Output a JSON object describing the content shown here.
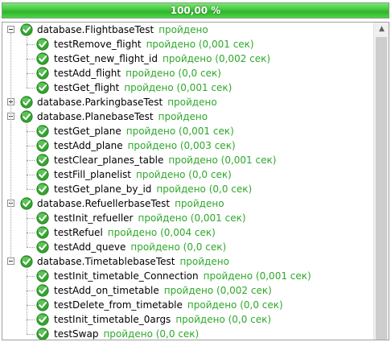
{
  "progress": {
    "label": "100,00 %",
    "fraction": 1.0,
    "color": "#3cc337"
  },
  "status_color": "#2ea82a",
  "icons": {
    "pass": "green-check-icon",
    "expand": "expander-icon",
    "scroll_up": "arrow-up-icon"
  },
  "suites": [
    {
      "name": "database.FlightbaseTest",
      "status": "пройдено",
      "expanded": true,
      "tests": [
        {
          "name": "testRemove_flight",
          "status": "пройдено (0,001 сек)"
        },
        {
          "name": "testGet_new_flight_id",
          "status": "пройдено (0,002 сек)"
        },
        {
          "name": "testAdd_flight",
          "status": "пройдено (0,0 сек)"
        },
        {
          "name": "testGet_flight",
          "status": "пройдено (0,001 сек)"
        }
      ]
    },
    {
      "name": "database.ParkingbaseTest",
      "status": "пройдено",
      "expanded": false,
      "tests": []
    },
    {
      "name": "database.PlanebaseTest",
      "status": "пройдено",
      "expanded": true,
      "tests": [
        {
          "name": "testGet_plane",
          "status": "пройдено (0,001 сек)"
        },
        {
          "name": "testAdd_plane",
          "status": "пройдено (0,003 сек)"
        },
        {
          "name": "testClear_planes_table",
          "status": "пройдено (0,001 сек)"
        },
        {
          "name": "testFill_planelist",
          "status": "пройдено (0,0 сек)"
        },
        {
          "name": "testGet_plane_by_id",
          "status": "пройдено (0,0 сек)"
        }
      ]
    },
    {
      "name": "database.RefuellerbaseTest",
      "status": "пройдено",
      "expanded": true,
      "tests": [
        {
          "name": "testInit_refueller",
          "status": "пройдено (0,001 сек)"
        },
        {
          "name": "testRefuel",
          "status": "пройдено (0,004 сек)"
        },
        {
          "name": "testAdd_queve",
          "status": "пройдено (0,0 сек)"
        }
      ]
    },
    {
      "name": "database.TimetablebaseTest",
      "status": "пройдено",
      "expanded": true,
      "tests": [
        {
          "name": "testInit_timetable_Connection",
          "status": "пройдено (0,001 сек)"
        },
        {
          "name": "testAdd_on_timetable",
          "status": "пройдено (0,002 сек)"
        },
        {
          "name": "testDelete_from_timetable",
          "status": "пройдено (0,0 сек)"
        },
        {
          "name": "testInit_timetable_0args",
          "status": "пройдено (0,0 сек)"
        },
        {
          "name": "testSwap",
          "status": "пройдено (0,0 сек)"
        }
      ]
    }
  ]
}
